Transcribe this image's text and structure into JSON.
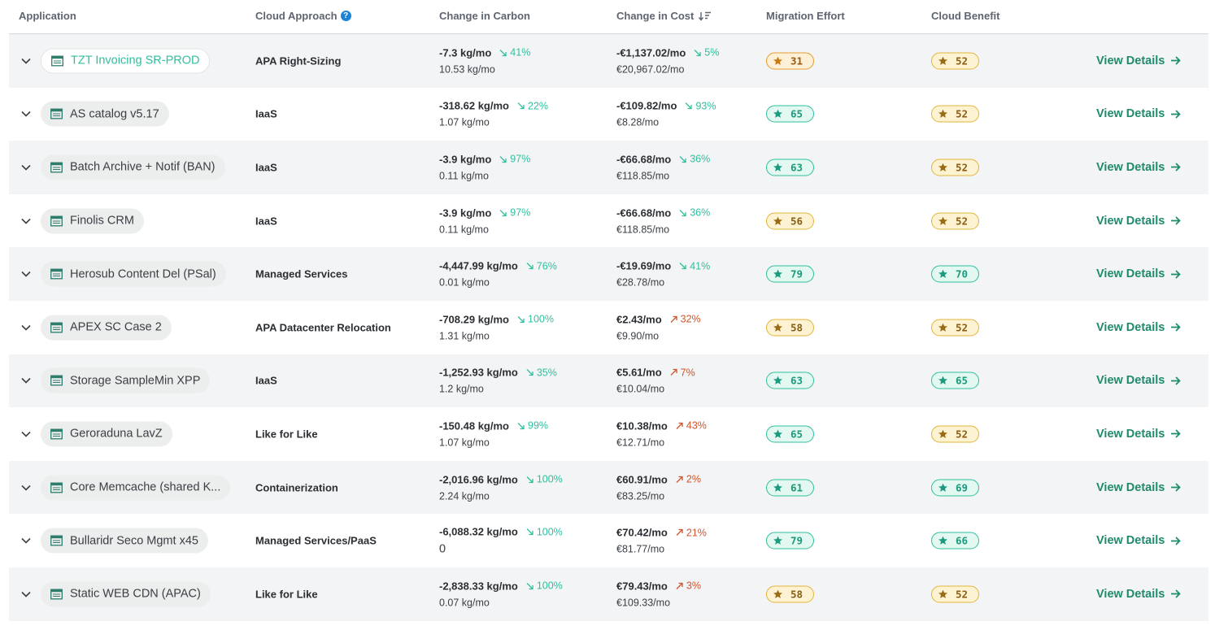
{
  "header": {
    "application": "Application",
    "cloud_approach": "Cloud Approach",
    "change_in_carbon": "Change in Carbon",
    "change_in_cost": "Change in Cost",
    "migration_effort": "Migration Effort",
    "cloud_benefit": "Cloud Benefit"
  },
  "colors": {
    "accent_green": "#2fbf9e",
    "link_green": "#1f8a6c",
    "increase_red": "#d0542b",
    "badge_gold": "#e2b43a",
    "badge_orange": "#e59b2c"
  },
  "rows": [
    {
      "app": "TZT Invoicing SR-PROD",
      "approach": "APA Right-Sizing",
      "carbon": "-7.3 kg/mo",
      "carbon_pct": "41%",
      "carbon_dir": "down",
      "carbon_base": "10.53 kg/mo",
      "cost": "-€1,137.02/mo",
      "cost_pct": "5%",
      "cost_dir": "down",
      "cost_base": "€20,967.02/mo",
      "effort": "31",
      "effort_color": "orange",
      "benefit": "52",
      "benefit_color": "gold",
      "details": "View Details"
    },
    {
      "app": "AS catalog v5.17",
      "approach": "IaaS",
      "carbon": "-318.62 kg/mo",
      "carbon_pct": "22%",
      "carbon_dir": "down",
      "carbon_base": "1.07 kg/mo",
      "cost": "-€109.82/mo",
      "cost_pct": "93%",
      "cost_dir": "down",
      "cost_base": "€8.28/mo",
      "effort": "65",
      "effort_color": "green",
      "benefit": "52",
      "benefit_color": "gold",
      "details": "View Details"
    },
    {
      "app": "Batch Archive + Notif (BAN)",
      "approach": "IaaS",
      "carbon": "-3.9 kg/mo",
      "carbon_pct": "97%",
      "carbon_dir": "down",
      "carbon_base": "0.11 kg/mo",
      "cost": "-€66.68/mo",
      "cost_pct": "36%",
      "cost_dir": "down",
      "cost_base": "€118.85/mo",
      "effort": "63",
      "effort_color": "green",
      "benefit": "52",
      "benefit_color": "gold",
      "details": "View Details"
    },
    {
      "app": "Finolis CRM",
      "approach": "IaaS",
      "carbon": "-3.9 kg/mo",
      "carbon_pct": "97%",
      "carbon_dir": "down",
      "carbon_base": "0.11 kg/mo",
      "cost": "-€66.68/mo",
      "cost_pct": "36%",
      "cost_dir": "down",
      "cost_base": "€118.85/mo",
      "effort": "56",
      "effort_color": "gold",
      "benefit": "52",
      "benefit_color": "gold",
      "details": "View Details"
    },
    {
      "app": "Herosub Content Del (PSal)",
      "approach": "Managed Services",
      "carbon": "-4,447.99 kg/mo",
      "carbon_pct": "76%",
      "carbon_dir": "down",
      "carbon_base": "0.01 kg/mo",
      "cost": "-€19.69/mo",
      "cost_pct": "41%",
      "cost_dir": "down",
      "cost_base": "€28.78/mo",
      "effort": "79",
      "effort_color": "green",
      "benefit": "70",
      "benefit_color": "green",
      "details": "View Details"
    },
    {
      "app": "APEX SC Case 2",
      "approach": "APA Datacenter Relocation",
      "carbon": "-708.29 kg/mo",
      "carbon_pct": "100%",
      "carbon_dir": "down",
      "carbon_base": "1.31 kg/mo",
      "cost": "€2.43/mo",
      "cost_pct": "32%",
      "cost_dir": "up",
      "cost_base": "€9.90/mo",
      "effort": "58",
      "effort_color": "gold",
      "benefit": "52",
      "benefit_color": "gold",
      "details": "View Details"
    },
    {
      "app": "Storage SampleMin XPP",
      "approach": "IaaS",
      "carbon": "-1,252.93 kg/mo",
      "carbon_pct": "35%",
      "carbon_dir": "down",
      "carbon_base": "1.2 kg/mo",
      "cost": "€5.61/mo",
      "cost_pct": "7%",
      "cost_dir": "up",
      "cost_base": "€10.04/mo",
      "effort": "63",
      "effort_color": "green",
      "benefit": "65",
      "benefit_color": "green",
      "details": "View Details"
    },
    {
      "app": "Geroraduna LavZ",
      "approach": "Like for Like",
      "carbon": "-150.48 kg/mo",
      "carbon_pct": "99%",
      "carbon_dir": "down",
      "carbon_base": "1.07 kg/mo",
      "cost": "€10.38/mo",
      "cost_pct": "43%",
      "cost_dir": "up",
      "cost_base": "€12.71/mo",
      "effort": "65",
      "effort_color": "green",
      "benefit": "52",
      "benefit_color": "gold",
      "details": "View Details"
    },
    {
      "app": "Core Memcache (shared K...",
      "approach": "Containerization",
      "carbon": "-2,016.96 kg/mo",
      "carbon_pct": "100%",
      "carbon_dir": "down",
      "carbon_base": "2.24 kg/mo",
      "cost": "€60.91/mo",
      "cost_pct": "2%",
      "cost_dir": "up",
      "cost_base": "€83.25/mo",
      "effort": "61",
      "effort_color": "green",
      "benefit": "69",
      "benefit_color": "green",
      "details": "View Details"
    },
    {
      "app": "Bullaridr Seco Mgmt x45",
      "approach": "Managed Services/PaaS",
      "carbon": "-6,088.32 kg/mo",
      "carbon_pct": "100%",
      "carbon_dir": "down",
      "carbon_base": "0",
      "cost": "€70.42/mo",
      "cost_pct": "21%",
      "cost_dir": "up",
      "cost_base": "€81.77/mo",
      "effort": "79",
      "effort_color": "green",
      "benefit": "66",
      "benefit_color": "green",
      "details": "View Details"
    },
    {
      "app": "Static WEB CDN (APAC)",
      "approach": "Like for Like",
      "carbon": "-2,838.33 kg/mo",
      "carbon_pct": "100%",
      "carbon_dir": "down",
      "carbon_base": "0.07 kg/mo",
      "cost": "€79.43/mo",
      "cost_pct": "3%",
      "cost_dir": "up",
      "cost_base": "€109.33/mo",
      "effort": "58",
      "effort_color": "gold",
      "benefit": "52",
      "benefit_color": "gold",
      "details": "View Details"
    }
  ]
}
